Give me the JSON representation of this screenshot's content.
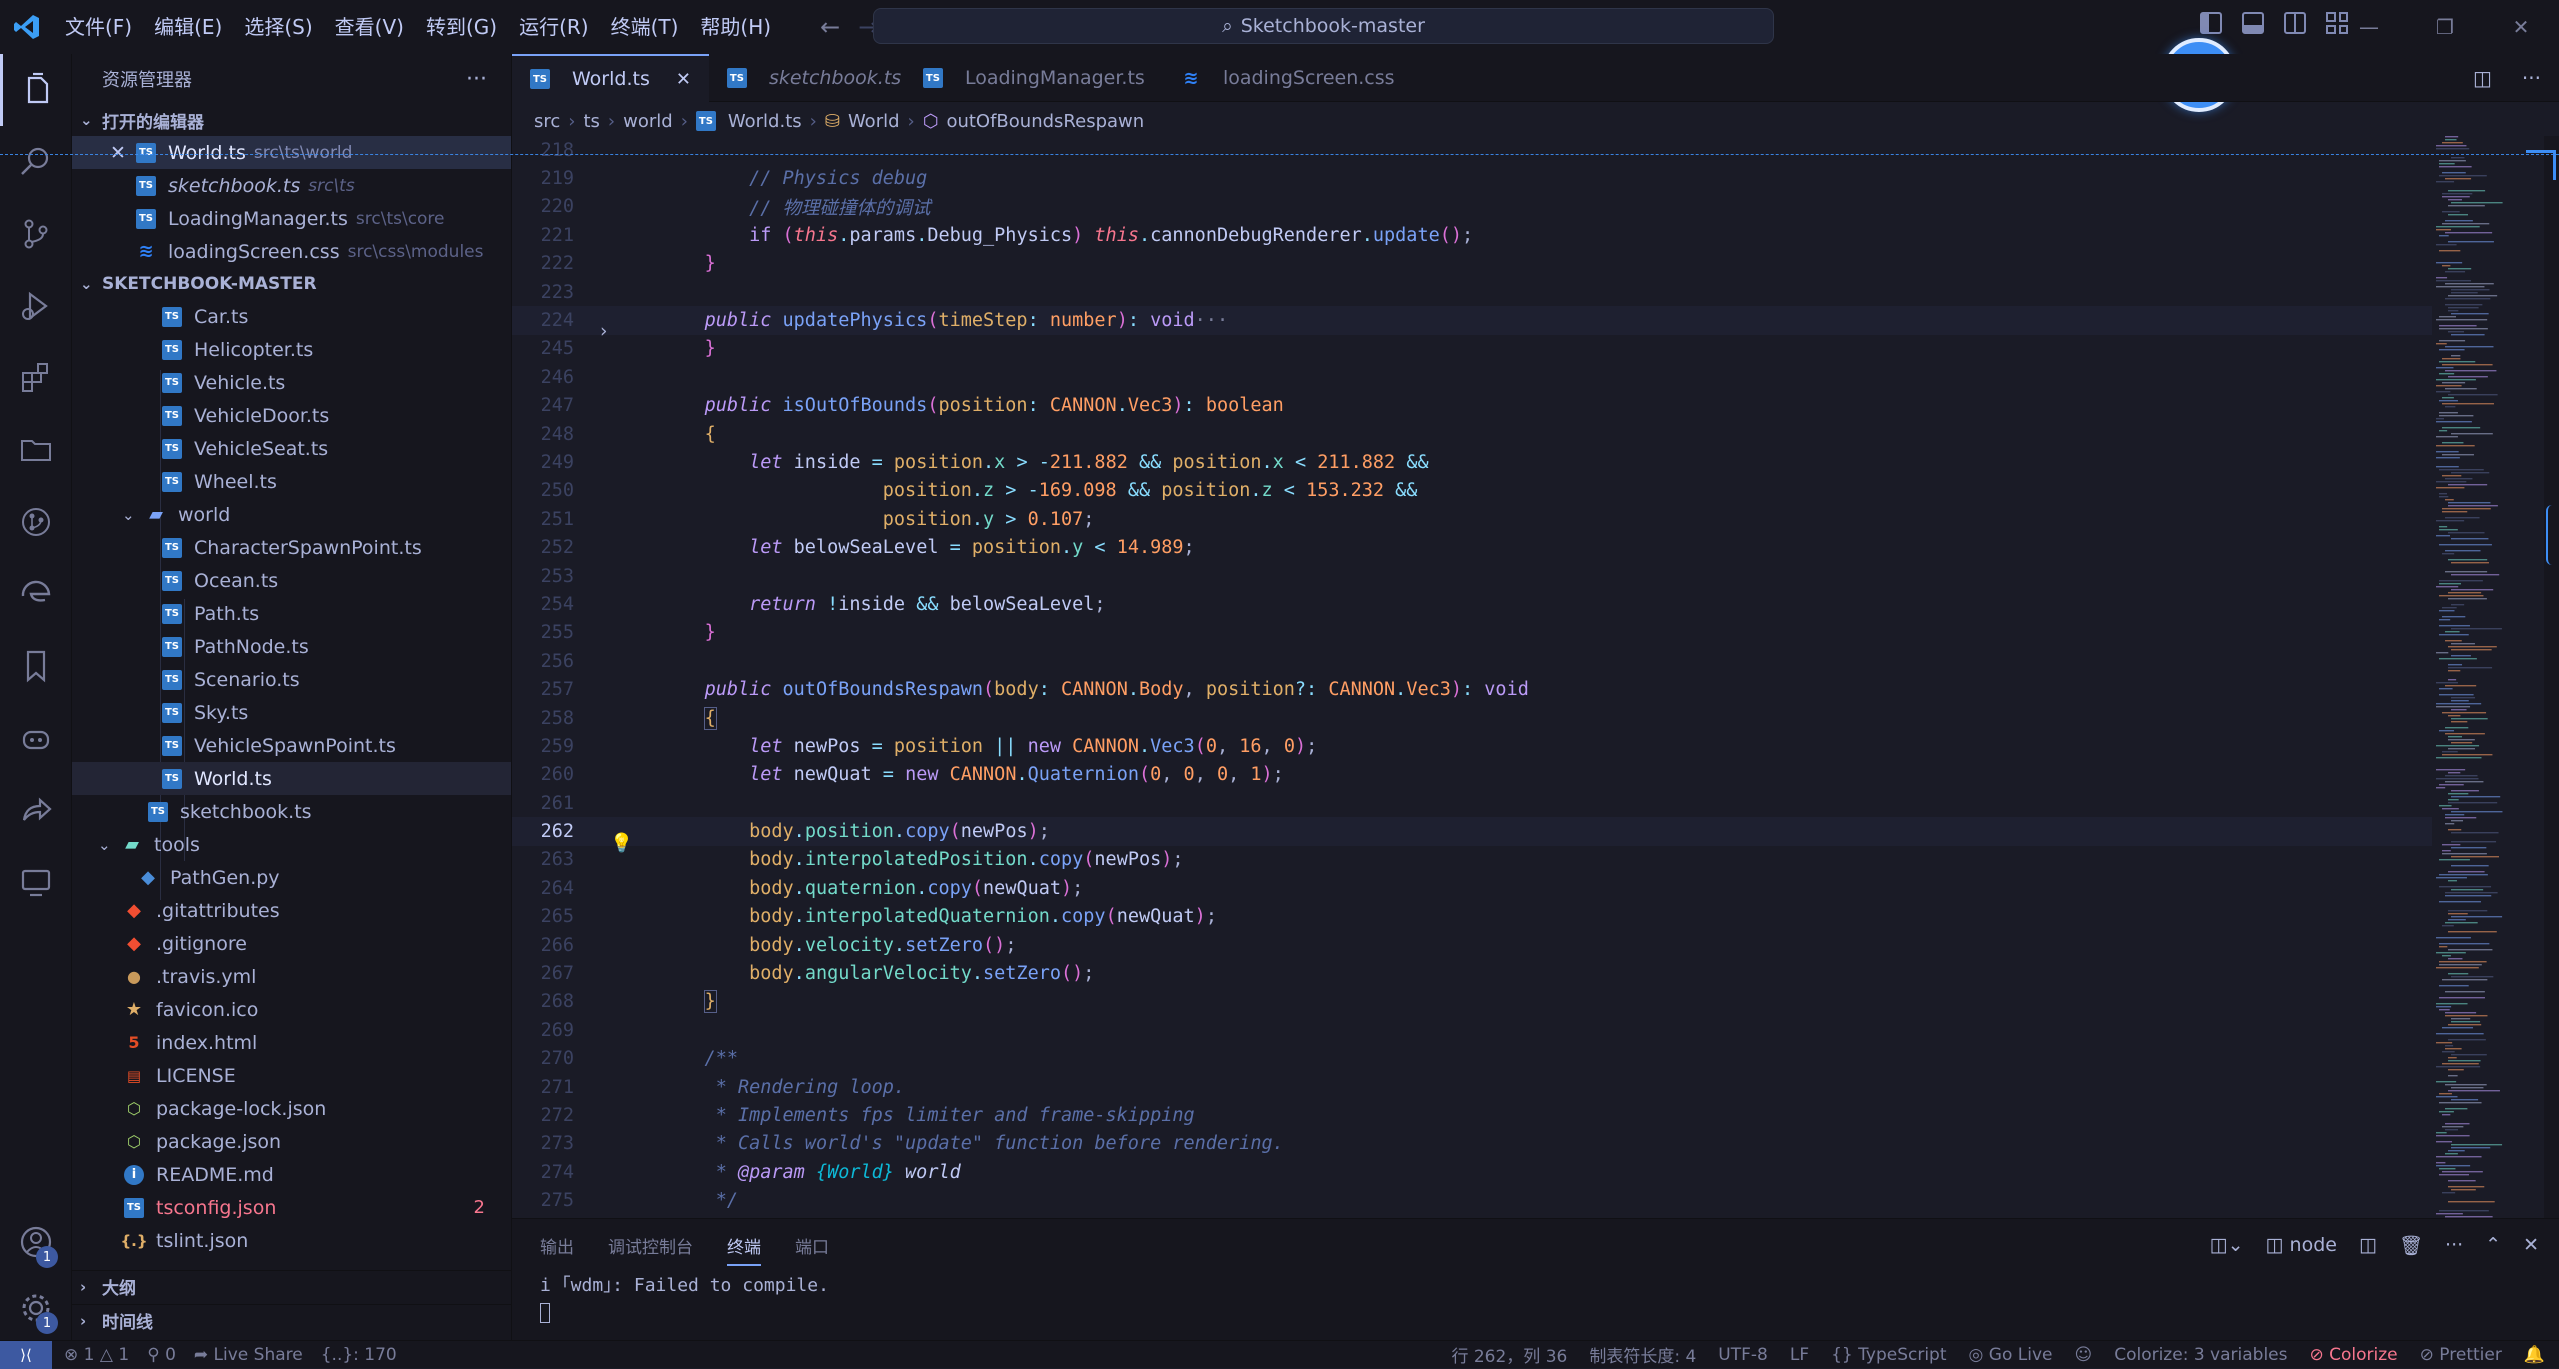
{
  "menu": [
    "文件(F)",
    "编辑(E)",
    "选择(S)",
    "查看(V)",
    "转到(G)",
    "运行(R)",
    "终端(T)",
    "帮助(H)"
  ],
  "search": "Sketchbook-master",
  "sidebar": {
    "title": "资源管理器",
    "open_editors_label": "打开的编辑器",
    "open_editors": [
      {
        "name": "World.ts",
        "desc": "src\\ts\\world"
      },
      {
        "name": "sketchbook.ts",
        "desc": "src\\ts"
      },
      {
        "name": "LoadingManager.ts",
        "desc": "src\\ts\\core"
      },
      {
        "name": "loadingScreen.css",
        "desc": "src\\css\\modules"
      }
    ],
    "project_label": "SKETCHBOOK-MASTER",
    "tree": [
      "Car.ts",
      "Helicopter.ts",
      "Vehicle.ts",
      "VehicleDoor.ts",
      "VehicleSeat.ts",
      "Wheel.ts",
      "world",
      "CharacterSpawnPoint.ts",
      "Ocean.ts",
      "Path.ts",
      "PathNode.ts",
      "Scenario.ts",
      "Sky.ts",
      "VehicleSpawnPoint.ts",
      "World.ts",
      "sketchbook.ts",
      "tools",
      "PathGen.py",
      ".gitattributes",
      ".gitignore",
      ".travis.yml",
      "favicon.ico",
      "index.html",
      "LICENSE",
      "package-lock.json",
      "package.json",
      "README.md",
      "tsconfig.json",
      "tslint.json"
    ],
    "tsconfig_problems": "2",
    "outline_label": "大纲",
    "timeline_label": "时间线"
  },
  "tabs": [
    {
      "label": "World.ts"
    },
    {
      "label": "sketchbook.ts"
    },
    {
      "label": "LoadingManager.ts"
    },
    {
      "label": "loadingScreen.css"
    }
  ],
  "breadcrumb": [
    "src",
    "ts",
    "world",
    "World.ts",
    "World",
    "outOfBoundsRespawn"
  ],
  "line_numbers": [
    "218",
    "219",
    "220",
    "221",
    "222",
    "223",
    "224",
    "245",
    "246",
    "247",
    "248",
    "249",
    "250",
    "251",
    "252",
    "253",
    "254",
    "255",
    "256",
    "257",
    "258",
    "259",
    "260",
    "261",
    "262",
    "263",
    "264",
    "265",
    "266",
    "267",
    "268",
    "269",
    "270",
    "271",
    "272",
    "273",
    "274",
    "275"
  ],
  "code_text": {
    "c219": "// Physics debug",
    "c220": "// 物理碰撞体的调试",
    "c271": "* Rendering loop.",
    "c272": "* Implements fps limiter and frame-skipping",
    "c273": "* Calls world's \"update\" function before rendering.",
    "c274_tag": "@param",
    "c274_type": "{World}",
    "c274_name": "world"
  },
  "panel": {
    "tabs": [
      "输出",
      "调试控制台",
      "终端",
      "端口"
    ],
    "terminal_name": "node",
    "output": "i ｢wdm｣: Failed to compile."
  },
  "status": {
    "errors": "1",
    "warnings": "1",
    "ports": "0",
    "live_share": "Live Share",
    "selection": "{..}: 170",
    "position": "行 262，列 36",
    "tab_size": "制表符长度: 4",
    "encoding": "UTF-8",
    "eol": "LF",
    "language": "TypeScript",
    "go_live": "Go Live",
    "colorize_vars": "Colorize: 3 variables",
    "colorize": "Colorize",
    "prettier": "Prettier"
  },
  "badges": {
    "account": "1",
    "settings": "1"
  },
  "colors": {
    "accent": "#7aa2f7",
    "background": "#1a1b26",
    "sidebar": "#16161e",
    "error": "#f7768e"
  }
}
